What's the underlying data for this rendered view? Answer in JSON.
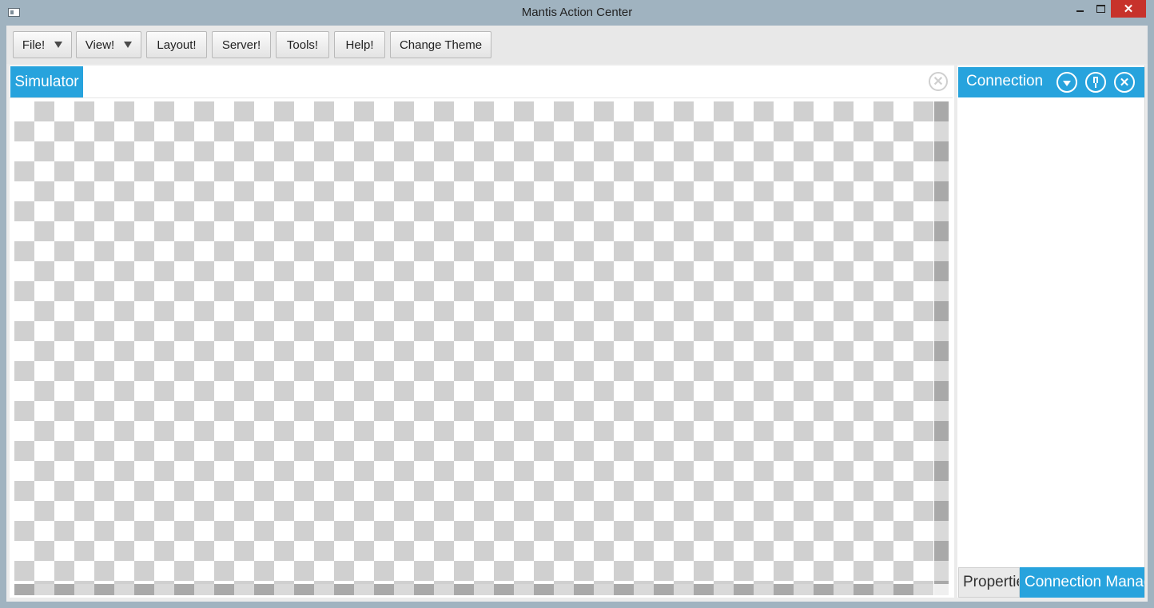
{
  "window": {
    "title": "Mantis Action Center",
    "controls": {
      "close_glyph": "✕"
    }
  },
  "toolbar": {
    "buttons": [
      {
        "label": "File!",
        "has_dropdown": true
      },
      {
        "label": "View!",
        "has_dropdown": true
      },
      {
        "label": "Layout!",
        "has_dropdown": false
      },
      {
        "label": "Server!",
        "has_dropdown": false
      },
      {
        "label": "Tools!",
        "has_dropdown": false
      },
      {
        "label": "Help!",
        "has_dropdown": false
      },
      {
        "label": "Change Theme",
        "has_dropdown": false
      }
    ]
  },
  "simulator": {
    "tab_label": "Simulator",
    "close_glyph": "✕"
  },
  "connection_panel": {
    "title": "Connection",
    "close_glyph": "✕",
    "bottom_tabs": [
      {
        "label": "Properties",
        "active": false
      },
      {
        "label": "Connection Manager",
        "active": true
      }
    ]
  },
  "colors": {
    "accent": "#27a3dd",
    "window_frame": "#a0b3c0",
    "close_button": "#c7322b",
    "checker_dark": "#d0d0d0"
  },
  "icons": [
    "app-icon",
    "minimize-icon",
    "maximize-icon",
    "close-icon",
    "dropdown-arrow-icon",
    "pin-icon"
  ]
}
